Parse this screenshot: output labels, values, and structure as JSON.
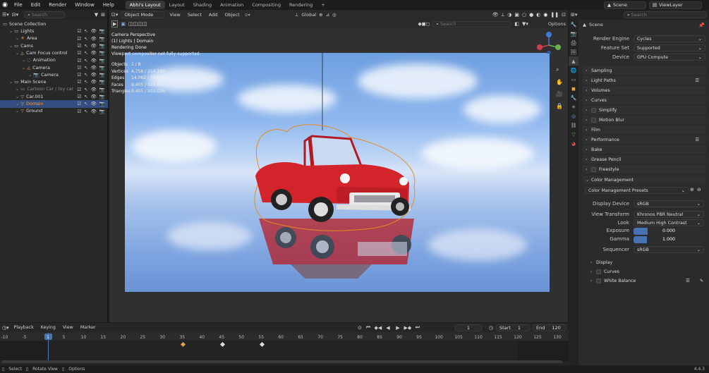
{
  "menu": [
    "File",
    "Edit",
    "Render",
    "Window",
    "Help"
  ],
  "workspaces": [
    "Abhi's Layout",
    "Layout",
    "Shading",
    "Animation",
    "Compositing",
    "Rendering"
  ],
  "top_right": {
    "scene": "Scene",
    "view_layer": "ViewLayer"
  },
  "outliner": {
    "search_placeholder": "Search",
    "rows": [
      {
        "label": "Scene Collection",
        "indent": 0
      },
      {
        "label": "Lights",
        "indent": 1
      },
      {
        "label": "Area",
        "indent": 2
      },
      {
        "label": "Cams",
        "indent": 1
      },
      {
        "label": "Cam Focus control",
        "indent": 2
      },
      {
        "label": "Animation",
        "indent": 3
      },
      {
        "label": "Camera",
        "indent": 3
      },
      {
        "label": "Camera",
        "indent": 4
      },
      {
        "label": "Main Scene",
        "indent": 1
      },
      {
        "label": "Cartoon Car / toy car",
        "indent": 2
      },
      {
        "label": "Car.001",
        "indent": 2
      },
      {
        "label": "Domain",
        "indent": 2
      },
      {
        "label": "Ground",
        "indent": 2
      }
    ]
  },
  "viewport_header": {
    "mode": "Object Mode",
    "menus": [
      "View",
      "Select",
      "Add",
      "Object"
    ],
    "orientation": "Global",
    "options": "Options",
    "search_placeholder": "Search"
  },
  "viewport_overlay": {
    "line1": "Camera Perspective",
    "line2": "(1) Lights | Domain",
    "line3": "Rendering Done",
    "line4": "Viewport compositor not fully supported",
    "stats": [
      {
        "k": "Objects",
        "v": "1 / 8"
      },
      {
        "k": "Vertices",
        "v": "4,758 / 254,180"
      },
      {
        "k": "Edges",
        "v": "14,062 / 750,942"
      },
      {
        "k": "Faces",
        "v": "9,405 / 501,687"
      },
      {
        "k": "Triangles",
        "v": "9,405 / 502,026"
      }
    ]
  },
  "properties": {
    "header": "Scene",
    "search_placeholder": "Search",
    "render_engine_label": "Render Engine",
    "render_engine": "Cycles",
    "feature_set_label": "Feature Set",
    "feature_set": "Supported",
    "device_label": "Device",
    "device": "GPU Compute",
    "sections": [
      "Sampling",
      "Light Paths",
      "Volumes",
      "Curves",
      "Simplify",
      "Motion Blur",
      "Film",
      "Performance",
      "Bake",
      "Grease Pencil",
      "Freestyle",
      "Color Management"
    ],
    "cm_presets": "Color Management Presets",
    "display_device_label": "Display Device",
    "display_device": "sRGB",
    "view_transform_label": "View Transform",
    "view_transform": "Khronos PBR Neutral",
    "look_label": "Look",
    "look": "Medium High Contrast",
    "exposure_label": "Exposure",
    "exposure": "0.000",
    "gamma_label": "Gamma",
    "gamma": "1.000",
    "sequencer_label": "Sequencer",
    "sequencer": "sRGB",
    "subsections": [
      "Display",
      "Curves",
      "White Balance"
    ]
  },
  "timeline": {
    "menus": [
      "Playback",
      "Keying",
      "View",
      "Marker"
    ],
    "current_frame": "1",
    "start_label": "Start",
    "start": "1",
    "end_label": "End",
    "end": "120",
    "ticks": [
      "-10",
      "-5",
      "1",
      "5",
      "10",
      "15",
      "20",
      "25",
      "30",
      "35",
      "40",
      "45",
      "50",
      "55",
      "60",
      "65",
      "70",
      "75",
      "80",
      "85",
      "90",
      "95",
      "100",
      "105",
      "110",
      "115",
      "120",
      "125",
      "130"
    ]
  },
  "statusbar": {
    "items": [
      "Select",
      "Rotate View",
      "Options"
    ],
    "version": "4.4.3"
  },
  "colors": {
    "accent": "#4772b3",
    "selected_row": "#334d80",
    "car_red": "#d3242c",
    "sky": "#8fb7ee"
  }
}
